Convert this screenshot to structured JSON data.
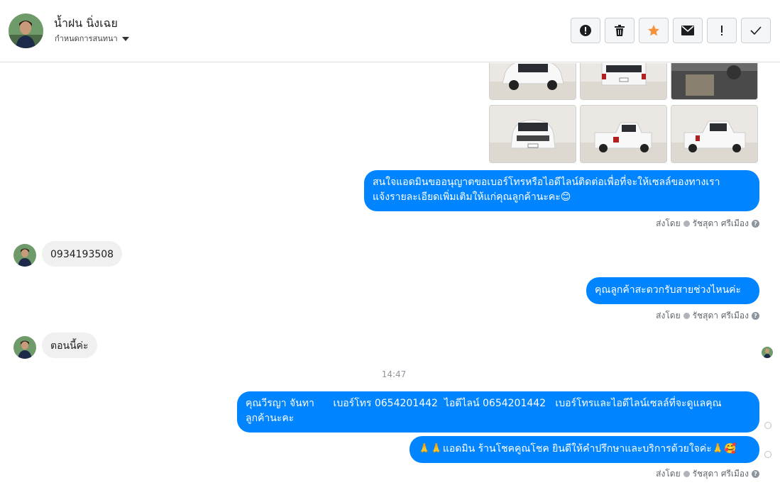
{
  "header": {
    "name": "น้ำฝน นิ่งเฉย",
    "subtitle": "กำหนดการสนทนา",
    "actions": [
      {
        "icon": "alert-circle-icon"
      },
      {
        "icon": "trash-icon"
      },
      {
        "icon": "star-icon"
      },
      {
        "icon": "envelope-icon"
      },
      {
        "icon": "exclamation-icon"
      },
      {
        "icon": "checkmark-icon"
      }
    ]
  },
  "messages": {
    "m1": "สนใจแอดมินขออนุญาตขอเบอร์โทรหรือไอดีไลน์ติดต่อเพื่อที่จะให้เซลล์ของทางเรา\nแจ้งรายละเอียดเพิ่มเติมให้แก่คุณลูกค้านะคะ😊",
    "m2": "0934193508",
    "m3": "คุณลูกค้าสะดวกรับสายช่วงไหนค่ะ",
    "m4": "ตอนนี้ค่ะ",
    "time": "14:47",
    "m5": "คุณวีรญา จันทา      เบอร์โทร 0654201442  ไอดีไลน์ 0654201442   เบอร์โทรและไอดีไลน์เซลล์ที่จะดูแลคุณ\nลูกค้านะคะ",
    "m6": "🙏🙏แอดมิน ร้านโชคคูณโชค ยินดีให้คำปรึกษาและบริการด้วยใจค่ะ🙏🥰"
  },
  "sent_by": {
    "label": "ส่งโดย",
    "agent": "รัชสุดา ศรีเมือง"
  },
  "colors": {
    "outgoing": "#0084ff",
    "incoming": "#f0f0f0",
    "star": "#f7923a"
  }
}
